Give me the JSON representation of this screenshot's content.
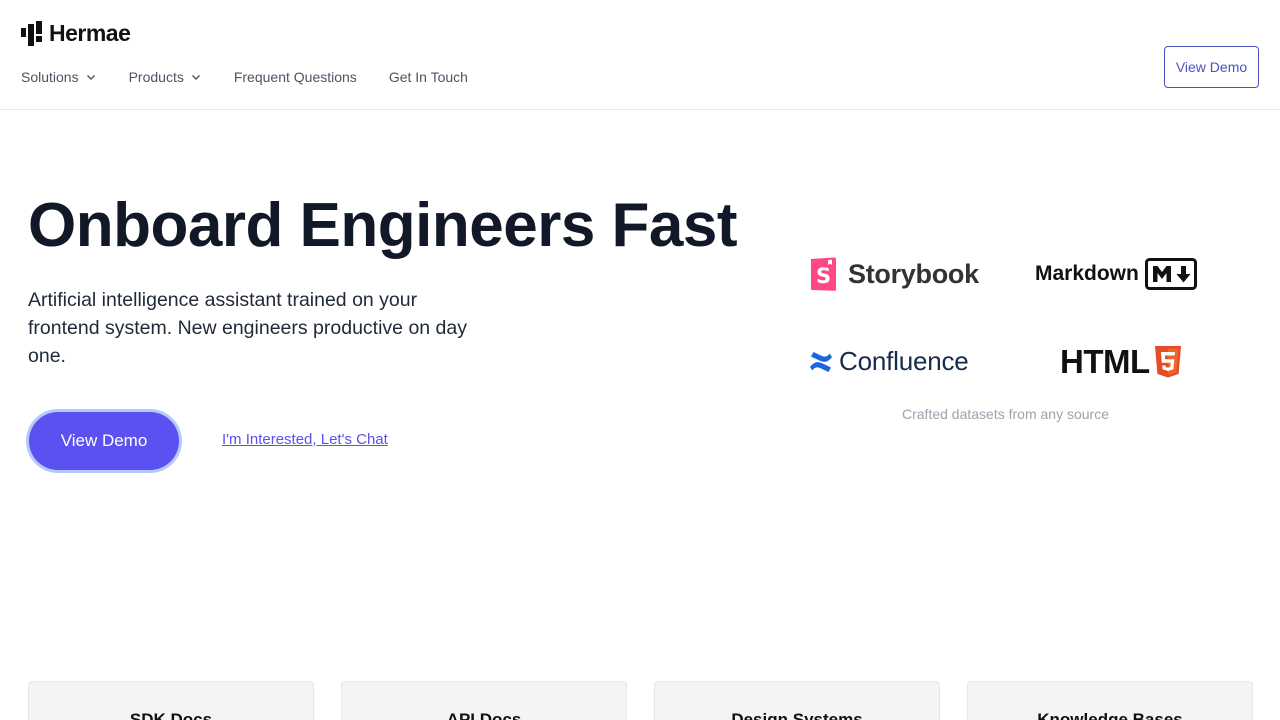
{
  "header": {
    "logo_text": "Hermae",
    "nav": [
      {
        "label": "Solutions",
        "has_dropdown": true
      },
      {
        "label": "Products",
        "has_dropdown": true
      },
      {
        "label": "Frequent Questions",
        "has_dropdown": false
      },
      {
        "label": "Get In Touch",
        "has_dropdown": false
      }
    ],
    "demo_button": "View Demo"
  },
  "hero": {
    "title": "Onboard Engineers Fast",
    "subtitle": "Artificial intelligence assistant trained on your frontend system. New engineers productive on day one.",
    "primary_cta": "View Demo",
    "secondary_cta": "I'm Interested, Let's Chat"
  },
  "sources": {
    "logos": [
      {
        "name": "Storybook",
        "icon": "storybook-icon",
        "color": "#ff4785"
      },
      {
        "name": "Markdown",
        "icon": "markdown-icon",
        "color": "#111111"
      },
      {
        "name": "Confluence",
        "icon": "confluence-icon",
        "color": "#1868db"
      },
      {
        "name": "HTML",
        "icon": "html5-icon",
        "color": "#e44d26"
      }
    ],
    "caption": "Crafted datasets from any source"
  },
  "cards": [
    {
      "title": "SDK Docs"
    },
    {
      "title": "API Docs"
    },
    {
      "title": "Design Systems"
    },
    {
      "title": "Knowledge Bases"
    }
  ],
  "colors": {
    "accent": "#5b50f0",
    "accent_ring": "#b7c7fb",
    "header_button_border": "#4c51bf"
  }
}
